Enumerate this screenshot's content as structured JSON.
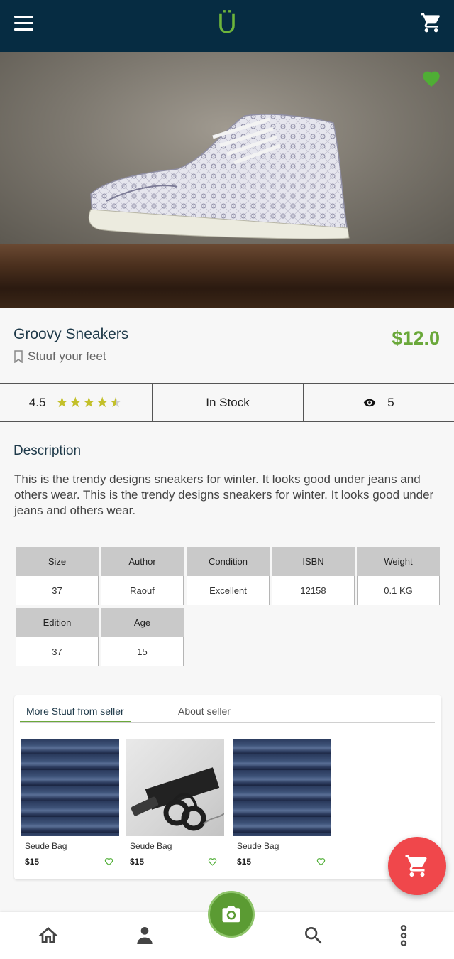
{
  "header": {
    "logo_text": "Ü",
    "menu_icon": "menu-icon",
    "cart_icon": "cart-icon"
  },
  "product": {
    "title": "Groovy Sneakers",
    "category": "Stuuf your feet",
    "price": "$12.0",
    "favorite": true
  },
  "stats": {
    "rating": "4.5",
    "rating_value": 4.5,
    "rating_max": 5,
    "stock": "In Stock",
    "views": "5"
  },
  "description": {
    "heading": "Description",
    "text": "This is the trendy designs sneakers for winter. It looks good under jeans and others wear. This is the trendy designs sneakers for winter. It looks good under jeans and others wear."
  },
  "specs": [
    {
      "label": "Size",
      "value": "37"
    },
    {
      "label": "Author",
      "value": "Raouf"
    },
    {
      "label": "Condition",
      "value": "Excellent"
    },
    {
      "label": "ISBN",
      "value": "12158"
    },
    {
      "label": "Weight",
      "value": "0.1 KG"
    },
    {
      "label": "Edition",
      "value": "37"
    },
    {
      "label": "Age",
      "value": "15"
    }
  ],
  "seller": {
    "tabs": [
      "More Stuuf from seller",
      "About seller"
    ],
    "active_tab": 0,
    "items": [
      {
        "name": "Seude Bag",
        "price": "$15"
      },
      {
        "name": "Seude Bag",
        "price": "$15"
      },
      {
        "name": "Seude Bag",
        "price": "$15"
      }
    ]
  },
  "bottom_nav": [
    "home-icon",
    "profile-icon",
    "camera-icon",
    "search-icon",
    "more-icon"
  ],
  "colors": {
    "header": "#062c42",
    "accent": "#6aa83a",
    "fab": "#f0474b",
    "star": "#c3c02a"
  }
}
